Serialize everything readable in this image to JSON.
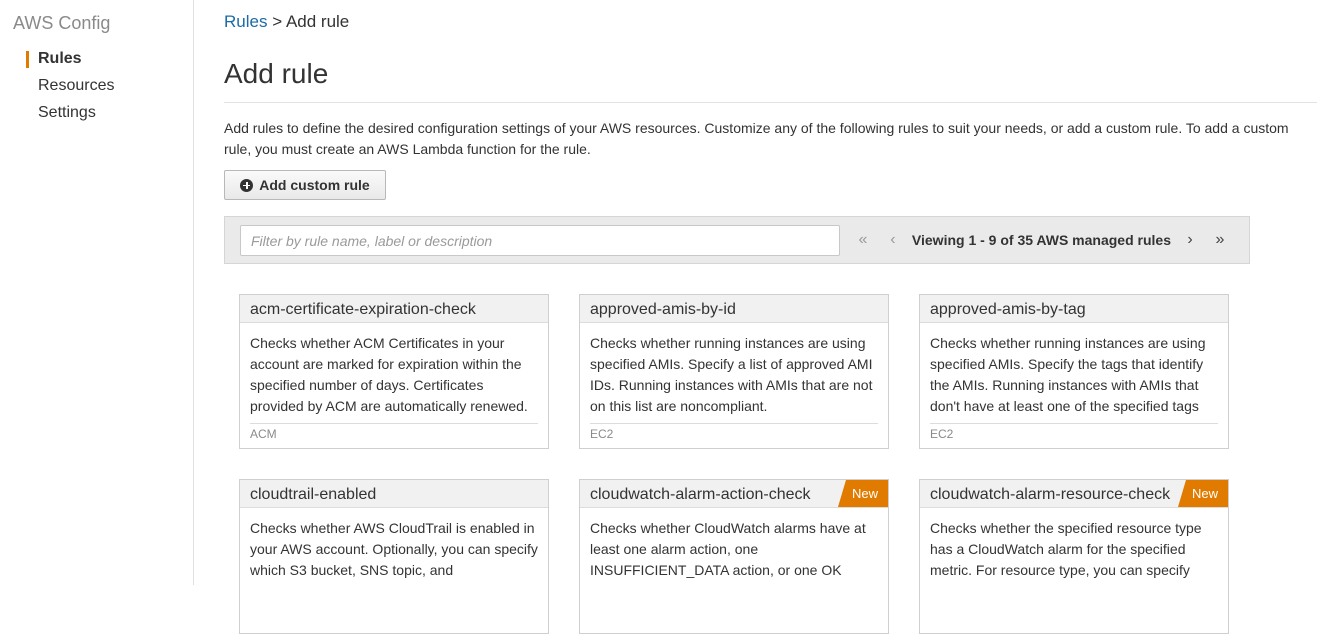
{
  "app": {
    "title": "AWS Config"
  },
  "sidebar": {
    "items": [
      {
        "label": "Rules",
        "active": true
      },
      {
        "label": "Resources",
        "active": false
      },
      {
        "label": "Settings",
        "active": false
      }
    ]
  },
  "breadcrumb": {
    "parent": "Rules",
    "separator": ">",
    "current": "Add rule"
  },
  "page": {
    "title": "Add rule",
    "description": "Add rules to define the desired configuration settings of your AWS resources. Customize any of the following rules to suit your needs, or add a custom rule. To add a custom rule, you must create an AWS Lambda function for the rule.",
    "add_custom_rule_label": "Add custom rule"
  },
  "filter": {
    "placeholder": "Filter by rule name, label or description",
    "pager": {
      "first": "«",
      "prev": "‹",
      "viewing": "Viewing 1 - 9 of 35 AWS managed rules",
      "next": "›",
      "last": "»"
    }
  },
  "cards": [
    {
      "name": "acm-certificate-expiration-check",
      "description": "Checks whether ACM Certificates in your account are marked for expiration within the specified number of days. Certificates provided by ACM are automatically renewed.",
      "label": "ACM",
      "badge": ""
    },
    {
      "name": "approved-amis-by-id",
      "description": "Checks whether running instances are using specified AMIs. Specify a list of approved AMI IDs. Running instances with AMIs that are not on this list are noncompliant.",
      "label": "EC2",
      "badge": ""
    },
    {
      "name": "approved-amis-by-tag",
      "description": "Checks whether running instances are using specified AMIs. Specify the tags that identify the AMIs. Running instances with AMIs that don't have at least one of the specified tags",
      "label": "EC2",
      "badge": ""
    },
    {
      "name": "cloudtrail-enabled",
      "description": "Checks whether AWS CloudTrail is enabled in your AWS account. Optionally, you can specify which S3 bucket, SNS topic, and",
      "label": "",
      "badge": ""
    },
    {
      "name": "cloudwatch-alarm-action-check",
      "description": "Checks whether CloudWatch alarms have at least one alarm action, one INSUFFICIENT_DATA action, or one OK",
      "label": "",
      "badge": "New"
    },
    {
      "name": "cloudwatch-alarm-resource-check",
      "description": "Checks whether the specified resource type has a CloudWatch alarm for the specified metric. For resource type, you can specify",
      "label": "",
      "badge": "New"
    }
  ],
  "colors": {
    "accent": "#e07b00",
    "link": "#1c6aa6"
  }
}
